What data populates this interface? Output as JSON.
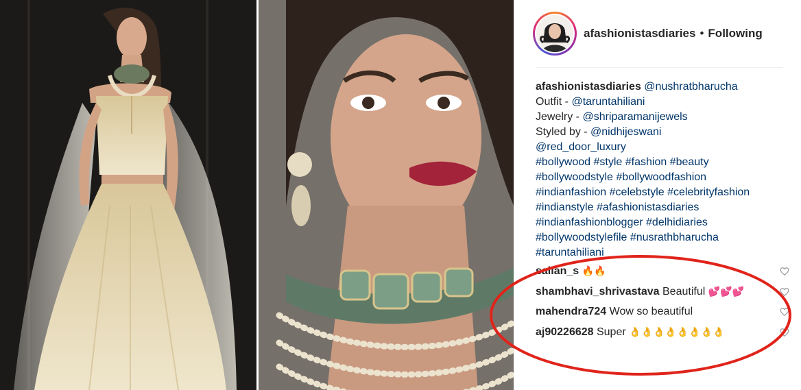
{
  "post": {
    "username": "afashionistasdiaries",
    "separator": "•",
    "follow_status": "Following"
  },
  "caption": {
    "username": "afashionistasdiaries",
    "mention_main": "@nushratbharucha",
    "outfit_label": "Outfit - ",
    "outfit_handle": "@taruntahiliani",
    "jewelry_label": "Jewelry - ",
    "jewelry_handle": "@shriparamanijewels",
    "styled_label": "Styled by - ",
    "styled_handle": "@nidhijeswani",
    "extra_handle": "@red_door_luxury",
    "hashtag_lines": [
      "#bollywood #style #fashion #beauty",
      "#bollywoodstyle #bollywoodfashion",
      "#indianfashion #celebstyle #celebrityfashion",
      "#indianstyle #afashionistasdiaries",
      "#indianfashionblogger #delhidiaries",
      "#bollywoodstylefile #nusrathbharucha",
      "#taruntahiliani"
    ]
  },
  "comments": [
    {
      "user": "salian_s",
      "text": "",
      "emoji": "🔥🔥"
    },
    {
      "user": "shambhavi_shrivastava",
      "text": "Beautiful",
      "emoji": "💕💕💕"
    },
    {
      "user": "mahendra724",
      "text": "Wow so beautiful",
      "emoji": ""
    },
    {
      "user": "aj90226628",
      "text": "Super",
      "emoji": "👌👌👌👌👌👌👌👌"
    }
  ],
  "colors": {
    "link": "#003569",
    "text": "#262626",
    "annotation_circle": "#e0241b",
    "heart_outline": "#999999"
  },
  "icons": {
    "heart": "heart-outline-icon",
    "avatar": "profile-avatar"
  }
}
